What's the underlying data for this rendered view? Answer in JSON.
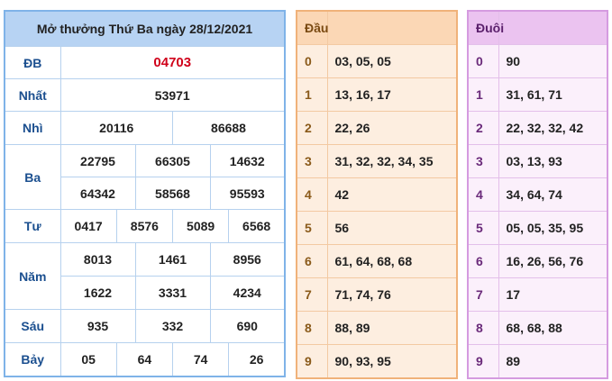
{
  "title": "Mở thưởng Thứ Ba ngày 28/12/2021",
  "prizes": {
    "db": {
      "label": "ĐB",
      "values": [
        "04703"
      ]
    },
    "nhat": {
      "label": "Nhất",
      "values": [
        "53971"
      ]
    },
    "nhi": {
      "label": "Nhì",
      "values": [
        "20116",
        "86688"
      ]
    },
    "ba": {
      "label": "Ba",
      "values": [
        "22795",
        "66305",
        "14632",
        "64342",
        "58568",
        "95593"
      ]
    },
    "tu": {
      "label": "Tư",
      "values": [
        "0417",
        "8576",
        "5089",
        "6568"
      ]
    },
    "nam": {
      "label": "Năm",
      "values": [
        "8013",
        "1461",
        "8956",
        "1622",
        "3331",
        "4234"
      ]
    },
    "sau": {
      "label": "Sáu",
      "values": [
        "935",
        "332",
        "690"
      ]
    },
    "bay": {
      "label": "Bảy",
      "values": [
        "05",
        "64",
        "74",
        "26"
      ]
    }
  },
  "dau": {
    "header": "Đầu",
    "rows": [
      {
        "k": "0",
        "v": "03, 05, 05"
      },
      {
        "k": "1",
        "v": "13, 16, 17"
      },
      {
        "k": "2",
        "v": "22, 26"
      },
      {
        "k": "3",
        "v": "31, 32, 32, 34, 35"
      },
      {
        "k": "4",
        "v": "42"
      },
      {
        "k": "5",
        "v": "56"
      },
      {
        "k": "6",
        "v": "61, 64, 68, 68"
      },
      {
        "k": "7",
        "v": "71, 74, 76"
      },
      {
        "k": "8",
        "v": "88, 89"
      },
      {
        "k": "9",
        "v": "90, 93, 95"
      }
    ]
  },
  "duoi": {
    "header": "Đuôi",
    "rows": [
      {
        "k": "0",
        "v": "90"
      },
      {
        "k": "1",
        "v": "31, 61, 71"
      },
      {
        "k": "2",
        "v": "22, 32, 32, 42"
      },
      {
        "k": "3",
        "v": "03, 13, 93"
      },
      {
        "k": "4",
        "v": "34, 64, 74"
      },
      {
        "k": "5",
        "v": "05, 05, 35, 95"
      },
      {
        "k": "6",
        "v": "16, 26, 56, 76"
      },
      {
        "k": "7",
        "v": "17"
      },
      {
        "k": "8",
        "v": "68, 68, 88"
      },
      {
        "k": "9",
        "v": "89"
      }
    ]
  },
  "colors": {
    "special_prize": "#d0021b",
    "main_border": "#7fb3e8",
    "dau_border": "#f0b27a",
    "duoi_border": "#d59be0"
  }
}
